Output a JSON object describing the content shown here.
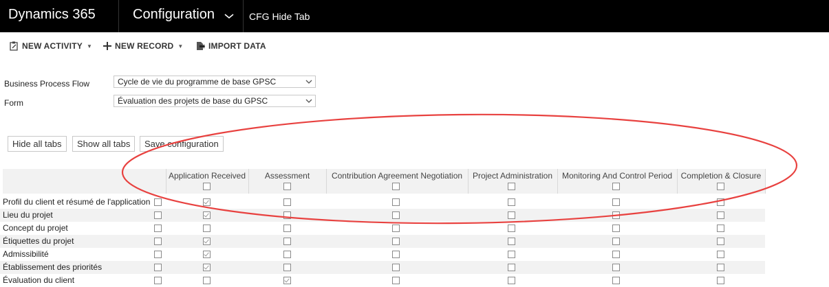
{
  "nav": {
    "brand": "Dynamics 365",
    "area": "Configuration",
    "entity": "CFG Hide Tab"
  },
  "commands": [
    {
      "label": "NEW ACTIVITY",
      "icon": "clipboard-edit-icon",
      "has_dropdown": true
    },
    {
      "label": "NEW RECORD",
      "icon": "plus-icon",
      "has_dropdown": true
    },
    {
      "label": "IMPORT DATA",
      "icon": "import-icon",
      "has_dropdown": false
    }
  ],
  "form": {
    "bpf_label": "Business Process Flow",
    "bpf_value": "Cycle de vie du programme de base GPSC",
    "form_label": "Form",
    "form_value": "Évaluation des projets de base du GPSC"
  },
  "buttons": {
    "hide_all": "Hide all tabs",
    "show_all": "Show all tabs",
    "save": "Save configuration"
  },
  "grid": {
    "columns": [
      "Application Received",
      "Assessment",
      "Contribution Agreement Negotiation",
      "Project Administration",
      "Monitoring And Control Period",
      "Completion & Closure"
    ],
    "header_checked": [
      false,
      false,
      false,
      false,
      false,
      false
    ],
    "rows": [
      {
        "label": "Profil du client et résumé de l'application",
        "all": false,
        "checks": [
          true,
          false,
          false,
          false,
          false,
          false
        ]
      },
      {
        "label": "Lieu du projet",
        "all": false,
        "checks": [
          true,
          false,
          false,
          false,
          false,
          false
        ]
      },
      {
        "label": "Concept du projet",
        "all": false,
        "checks": [
          false,
          false,
          false,
          false,
          false,
          false
        ]
      },
      {
        "label": "Étiquettes du projet",
        "all": false,
        "checks": [
          true,
          false,
          false,
          false,
          false,
          false
        ]
      },
      {
        "label": "Admissibilité",
        "all": false,
        "checks": [
          true,
          false,
          false,
          false,
          false,
          false
        ]
      },
      {
        "label": "Établissement des priorités",
        "all": false,
        "checks": [
          true,
          false,
          false,
          false,
          false,
          false
        ]
      },
      {
        "label": "Évaluation du client",
        "all": false,
        "checks": [
          false,
          true,
          false,
          false,
          false,
          false
        ]
      }
    ]
  },
  "colors": {
    "topbar": "#000000",
    "annotation": "#e8413f"
  }
}
